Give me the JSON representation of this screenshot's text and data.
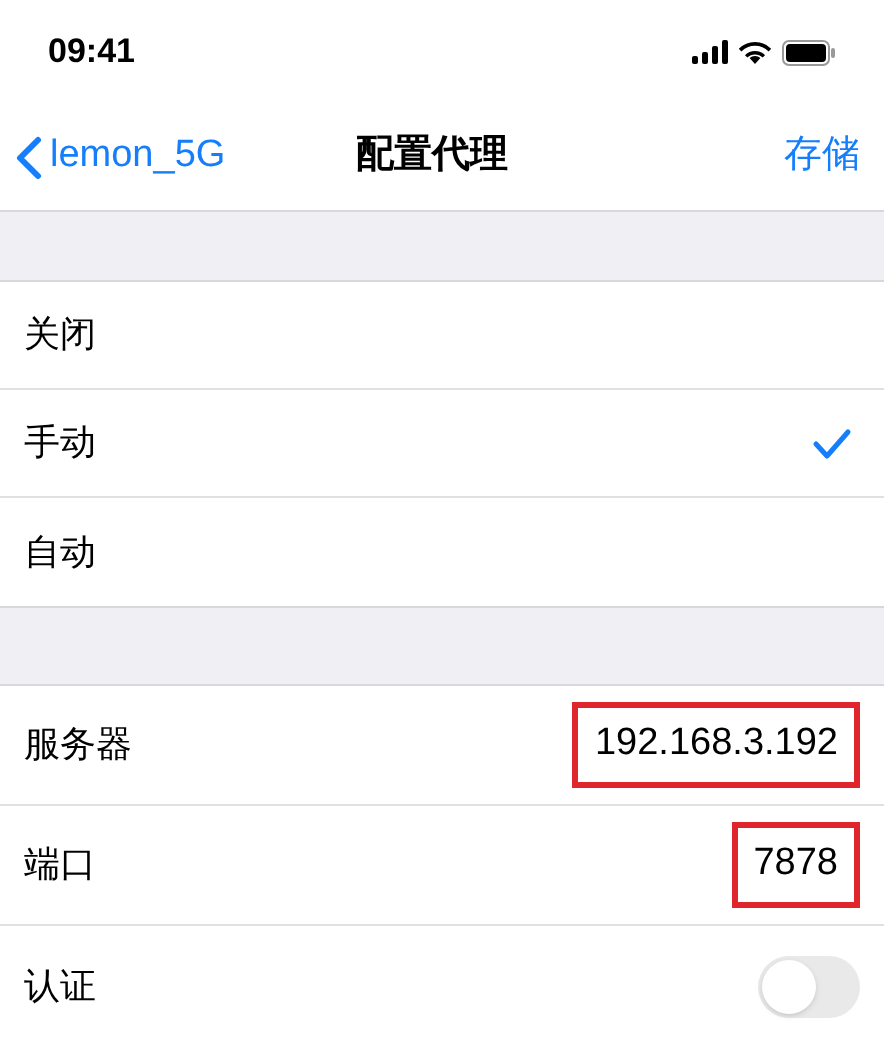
{
  "status_bar": {
    "time": "09:41"
  },
  "nav": {
    "back": "lemon_5G",
    "title": "配置代理",
    "action": "存储"
  },
  "modes": [
    {
      "label": "关闭",
      "selected": false
    },
    {
      "label": "手动",
      "selected": true
    },
    {
      "label": "自动",
      "selected": false
    }
  ],
  "fields": [
    {
      "kind": "text",
      "label": "服务器",
      "value": "192.168.3.192",
      "highlighted": true
    },
    {
      "kind": "text",
      "label": "端口",
      "value": "7878",
      "highlighted": true
    },
    {
      "kind": "toggle",
      "label": "认证",
      "on": false
    }
  ]
}
